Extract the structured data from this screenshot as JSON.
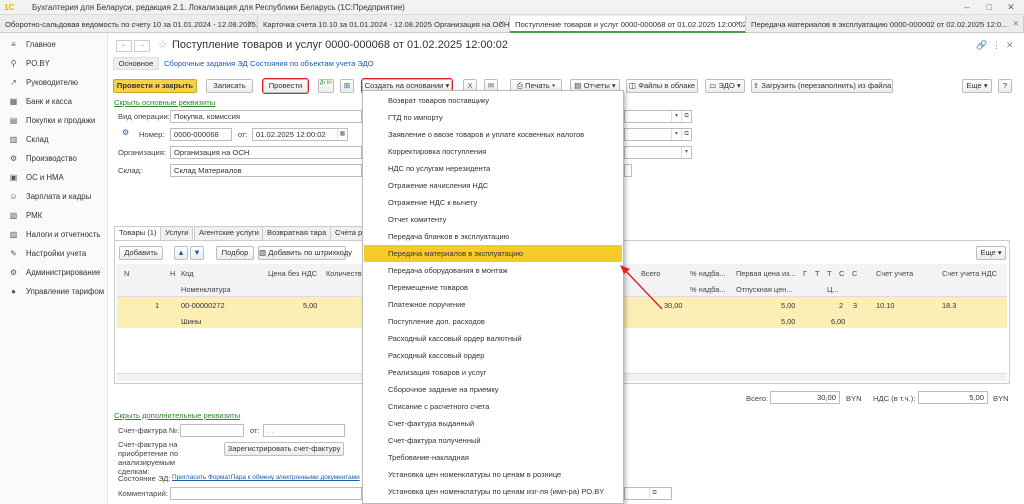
{
  "app": {
    "logo": "1С",
    "title": "Бухгалтерия для Беларуси, редакция 2.1. Локализация для Республики Беларусь  (1С:Предприятие)"
  },
  "tabs": [
    {
      "label": "Оборотно-сальдовая ведомость по счету 10 за 01.01.2024 - 12.08.2025..."
    },
    {
      "label": "Карточка счета 10.10 за 01.01.2024 - 12.08.2025 Организация на ОСН"
    },
    {
      "label": "Поступление товаров и услуг 0000-000068 от 01.02.2025 12:00:02"
    },
    {
      "label": "Передача материалов в эксплуатацию 0000-000002 от 02.02.2025 12:0..."
    }
  ],
  "sidebar": [
    {
      "label": "Главное",
      "icon": "≡"
    },
    {
      "label": "PO.BY",
      "icon": "⚲"
    },
    {
      "label": "Руководителю",
      "icon": "↗"
    },
    {
      "label": "Банк и касса",
      "icon": "▦"
    },
    {
      "label": "Покупки и продажи",
      "icon": "▤"
    },
    {
      "label": "Склад",
      "icon": "▥"
    },
    {
      "label": "Производство",
      "icon": "⚙"
    },
    {
      "label": "ОС и НМА",
      "icon": "▣"
    },
    {
      "label": "Зарплата и кадры",
      "icon": "☺"
    },
    {
      "label": "РМК",
      "icon": "▧"
    },
    {
      "label": "Налоги и отчетность",
      "icon": "▨"
    },
    {
      "label": "Настройки учета",
      "icon": "✎"
    },
    {
      "label": "Администрирование",
      "icon": "⚙"
    },
    {
      "label": "Управление тарифом",
      "icon": "●"
    }
  ],
  "doc": {
    "title": "Поступление товаров и услуг 0000-000068 от 01.02.2025 12:00:02",
    "subtabs": {
      "main": "Основное",
      "tasks": "Сборочные задания ЭД",
      "states": "Состояния по объектам учета ЭДО"
    }
  },
  "toolbar": {
    "post_close": "Провести и закрыть",
    "save": "Записать",
    "post": "Провести",
    "dtkt": "Дт Кт",
    "create_based": "Создать на основании",
    "print": "Печать",
    "reports": "Отчеты",
    "files": "Файлы в облаке",
    "edo": "ЭДО",
    "load": "Загрузить (перезаполнить) из файла",
    "more": "Еще",
    "help": "?"
  },
  "form": {
    "hide_main": "Скрыть основные реквизиты",
    "op_label": "Вид операции:",
    "op_value": "Покупка, комиссия",
    "num_label": "Номер:",
    "num_value": "0000-000068",
    "from_label": "от:",
    "date_value": "01.02.2025 12:00:02",
    "org_label": "Организация:",
    "org_value": "Организация на ОСН",
    "wh_label": "Склад:",
    "wh_value": "Склад Материалов"
  },
  "inner_tabs": [
    "Товары (1)",
    "Услуги",
    "Агентские услуги",
    "Возвратная тара",
    "Счета р"
  ],
  "table": {
    "add": "Добавить",
    "select": "Подбор",
    "barcode": "Добавить по штрихкоду",
    "more": "Еще",
    "headers_left": {
      "n": "N",
      "h": "Н",
      "code": "Код",
      "nom": "Номенклатура",
      "price": "Цена без НДС",
      "qty": "Количеств"
    },
    "headers_right": {
      "total": "Всего",
      "markup1": "% надба...",
      "first_price": "Первая цена из...",
      "g": "Г",
      "t": "Т",
      "t2": "Т",
      "s": "С",
      "s2": "С",
      "account": "Счет учета",
      "vat_account": "Счет учета НДС",
      "markup2": "% надба...",
      "retail": "Отпускная цен...",
      "c2": "Ц..."
    },
    "row": {
      "n": "1",
      "code": "00-00000272",
      "name": "Шины",
      "price": "5,00",
      "qty": "",
      "total": "30,00",
      "first_price": "5,00",
      "retail": "5,00",
      "c": "2",
      "num3": "3",
      "six": "6,00",
      "account": "10.10",
      "vat_account": "18.3"
    }
  },
  "totals": {
    "total_label": "Всего:",
    "total_value": "30,00",
    "cur": "BYN",
    "vat_label": "НДС (в т.ч.):",
    "vat_value": "5,00",
    "cur2": "BYN"
  },
  "bottom": {
    "hide_extra": "Скрыть дополнительные реквизиты",
    "invoice_label": "Счет-фактура №:",
    "from_label": "от:",
    "date_placeholder": ". .",
    "invoice_acq_label": "Счет-фактура на приобретение по анализируемым сделкам:",
    "register_btn": "Зарегистрировать счет-фактуру",
    "state_label": "Состояние ЭД:",
    "state_link": "Пригласить ФорматПара к обмену электронными документами",
    "comment_label": "Комментарий:"
  },
  "menu": [
    "Возврат товаров поставщику",
    "ГТД по импорту",
    "Заявление о ввозе товаров и уплате косвенных налогов",
    "Корректировка поступления",
    "НДС по услугам нерезидента",
    "Отражение начисления НДС",
    "Отражение НДС к вычету",
    "Отчет комитенту",
    "Передача бланков в эксплуатацию",
    "Передача материалов в эксплуатацию",
    "Передача оборудования в монтаж",
    "Перемещение товаров",
    "Платежное поручение",
    "Поступление доп. расходов",
    "Расходный кассовый ордер валютный",
    "Расходный кассовый ордер",
    "Реализация товаров и услуг",
    "Сборочное задание на приемку",
    "Списание с расчетного счета",
    "Счет-фактура выданный",
    "Счет-фактура полученный",
    "Требование-накладная",
    "Установка цен номенклатуры по ценам в рознице",
    "Установка цен номенклатуры по ценам изг-ля (имп-ра) РО.BY"
  ],
  "colors": {
    "accent_yellow": "#f6ca27",
    "annotation_red": "#dd2222",
    "active_tab": "#4b9b4b"
  }
}
